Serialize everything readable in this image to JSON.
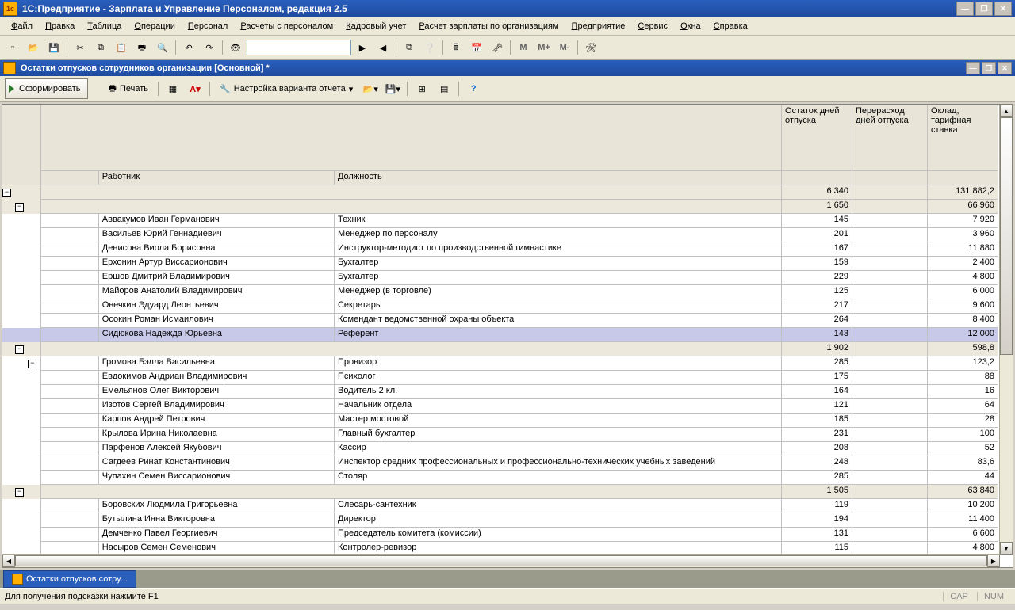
{
  "window": {
    "title": "1С:Предприятие - Зарплата и Управление Персоналом, редакция 2.5"
  },
  "menu": [
    "Файл",
    "Правка",
    "Таблица",
    "Операции",
    "Персонал",
    "Расчеты с персоналом",
    "Кадровый учет",
    "Расчет зарплаты по организациям",
    "Предприятие",
    "Сервис",
    "Окна",
    "Справка"
  ],
  "doc": {
    "title": "Остатки отпусков сотрудников организации [Основной] *"
  },
  "report_tb": {
    "generate": "Сформировать",
    "print": "Печать",
    "settings": "Настройка варианта отчета"
  },
  "headers": {
    "employee": "Работник",
    "position": "Должность",
    "balance": "Остаток дней отпуска",
    "over": "Перерасход дней отпуска",
    "salary": "Оклад, тарифная ставка"
  },
  "total": {
    "balance": "6 340",
    "salary": "131 882,2"
  },
  "groups": [
    {
      "subtotal": {
        "balance": "1 650",
        "salary": "66 960"
      },
      "rows": [
        {
          "name": "Аввакумов Иван Германович",
          "pos": "Техник",
          "bal": "145",
          "sal": "7 920",
          "sel": false
        },
        {
          "name": "Васильев Юрий Геннадиевич",
          "pos": "Менеджер по персоналу",
          "bal": "201",
          "sal": "3 960",
          "sel": false
        },
        {
          "name": "Денисова Виола Борисовна",
          "pos": "Инструктор-методист по производственной гимнастике",
          "bal": "167",
          "sal": "11 880",
          "sel": false
        },
        {
          "name": "Ерхонин Артур Виссарионович",
          "pos": "Бухгалтер",
          "bal": "159",
          "sal": "2 400",
          "sel": false
        },
        {
          "name": "Ершов Дмитрий Владимирович",
          "pos": "Бухгалтер",
          "bal": "229",
          "sal": "4 800",
          "sel": false
        },
        {
          "name": "Майоров Анатолий Владимирович",
          "pos": "Менеджер (в торговле)",
          "bal": "125",
          "sal": "6 000",
          "sel": false
        },
        {
          "name": "Овечкин Эдуард Леонтьевич",
          "pos": "Секретарь",
          "bal": "217",
          "sal": "9 600",
          "sel": false
        },
        {
          "name": "Осокин Роман Исмаилович",
          "pos": "Комендант ведомственной охраны объекта",
          "bal": "264",
          "sal": "8 400",
          "sel": false
        },
        {
          "name": "Сидюкова Надежда Юрьевна",
          "pos": "Референт",
          "bal": "143",
          "sal": "12 000",
          "sel": true
        }
      ]
    },
    {
      "subtotal": {
        "balance": "1 902",
        "salary": "598,8"
      },
      "rows": [
        {
          "name": "Громова Бэлла Васильевна",
          "pos": "Провизор",
          "bal": "285",
          "sal": "123,2",
          "sel": false
        },
        {
          "name": "Евдокимов Андриан Владимирович",
          "pos": "Психолог",
          "bal": "175",
          "sal": "88",
          "sel": false
        },
        {
          "name": "Емельянов Олег Викторович",
          "pos": "Водитель 2 кл.",
          "bal": "164",
          "sal": "16",
          "sel": false
        },
        {
          "name": "Изотов Сергей Владимирович",
          "pos": "Начальник отдела",
          "bal": "121",
          "sal": "64",
          "sel": false
        },
        {
          "name": "Карпов Андрей Петрович",
          "pos": "Мастер мостовой",
          "bal": "185",
          "sal": "28",
          "sel": false
        },
        {
          "name": "Крылова Ирина Николаевна",
          "pos": "Главный бухгалтер",
          "bal": "231",
          "sal": "100",
          "sel": false
        },
        {
          "name": "Парфенов Алексей Якубович",
          "pos": "Кассир",
          "bal": "208",
          "sal": "52",
          "sel": false
        },
        {
          "name": "Сагдеев Ринат Константинович",
          "pos": "Инспектор средних профессиональных и профессионально-технических учебных заведений",
          "bal": "248",
          "sal": "83,6",
          "sel": false
        },
        {
          "name": "Чупахин Семен Виссарионович",
          "pos": "Столяр",
          "bal": "285",
          "sal": "44",
          "sel": false
        }
      ]
    },
    {
      "subtotal": {
        "balance": "1 505",
        "salary": "63 840"
      },
      "rows": [
        {
          "name": "Боровских Людмила Григорьевна",
          "pos": "Слесарь-сантехник",
          "bal": "119",
          "sal": "10 200",
          "sel": false
        },
        {
          "name": "Бутылина Инна Викторовна",
          "pos": "Директор",
          "bal": "194",
          "sal": "11 400",
          "sel": false
        },
        {
          "name": "Демченко Павел Георгиевич",
          "pos": "Председатель комитета (комиссии)",
          "bal": "131",
          "sal": "6 600",
          "sel": false
        },
        {
          "name": "Насыров Семен Семенович",
          "pos": "Контролер-ревизор",
          "bal": "115",
          "sal": "4 800",
          "sel": false
        }
      ]
    }
  ],
  "wtab": "Остатки отпусков сотру...",
  "status": {
    "hint": "Для получения подсказки нажмите F1",
    "cap": "CAP",
    "num": "NUM"
  }
}
